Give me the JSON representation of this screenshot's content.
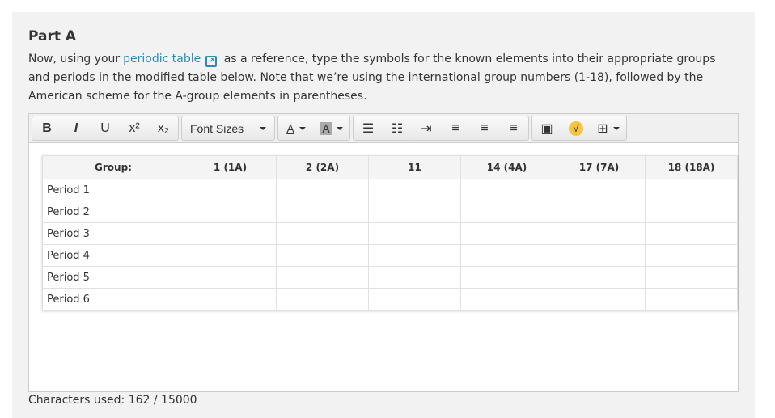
{
  "title": "Part A",
  "prompt": {
    "before": "Now, using your",
    "link": "periodic table",
    "after": "as a reference, type the symbols for the known elements into their appropriate groups and periods in the modified table below. Note that we’re using the international group numbers (1-18), followed by the American scheme for the A-group elements in parentheses."
  },
  "toolbar": {
    "bold": "B",
    "italic": "I",
    "underline": "U",
    "superscript": "x²",
    "subscript": "x₂",
    "font_sizes": "Font Sizes",
    "font_color": "A",
    "bg_color": "A"
  },
  "table": {
    "headers": [
      "Group:",
      "1 (1A)",
      "2 (2A)",
      "11",
      "14 (4A)",
      "17 (7A)",
      "18 (18A)"
    ],
    "rows": [
      "Period 1",
      "Period 2",
      "Period 3",
      "Period 4",
      "Period 5",
      "Period 6"
    ]
  },
  "footer": {
    "chars": "Characters used: 162 / 15000"
  },
  "colors": {
    "link": "#2a8bb5",
    "panel": "#f2f2f2"
  }
}
